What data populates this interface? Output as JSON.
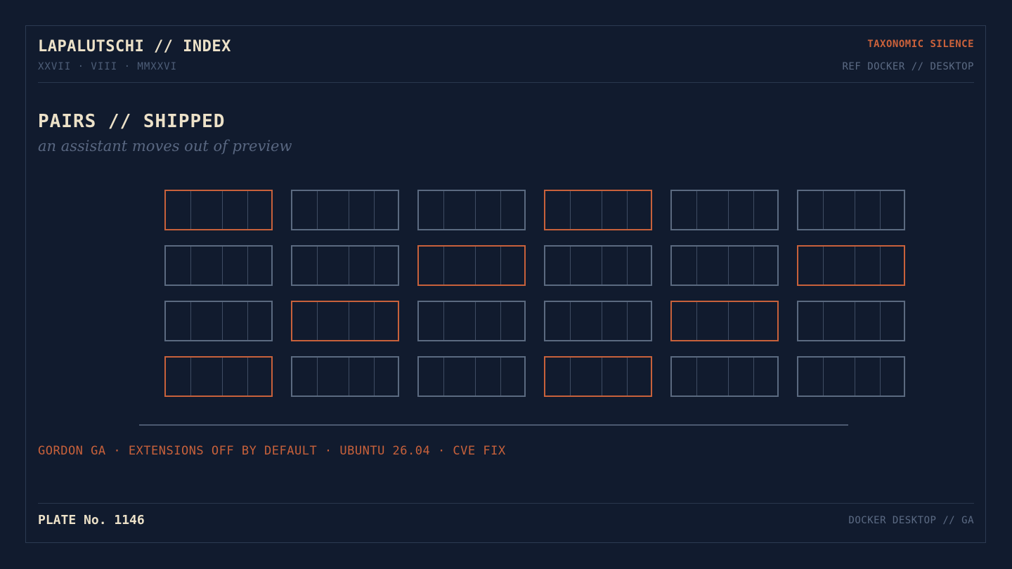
{
  "header": {
    "title": "LAPALUTSCHI // INDEX",
    "date": "XXVII · VIII · MMXXVI",
    "tag": "TAXONOMIC SILENCE",
    "ref": "REF DOCKER // DESKTOP"
  },
  "section": {
    "title": "PAIRS // SHIPPED",
    "subtitle": "an assistant moves out of preview"
  },
  "grid": {
    "rows": [
      [
        1,
        0,
        0,
        1,
        0,
        0
      ],
      [
        0,
        0,
        1,
        0,
        0,
        1
      ],
      [
        0,
        1,
        0,
        0,
        1,
        0
      ],
      [
        1,
        0,
        0,
        1,
        0,
        0
      ]
    ],
    "colors": {
      "highlight": "#c8613b",
      "normal": "#5b6a80"
    }
  },
  "tags": "GORDON GA · EXTENSIONS OFF BY DEFAULT · UBUNTU 26.04 · CVE FIX",
  "footer": {
    "plate": "PLATE No. 1146",
    "ref": "DOCKER DESKTOP // GA"
  }
}
